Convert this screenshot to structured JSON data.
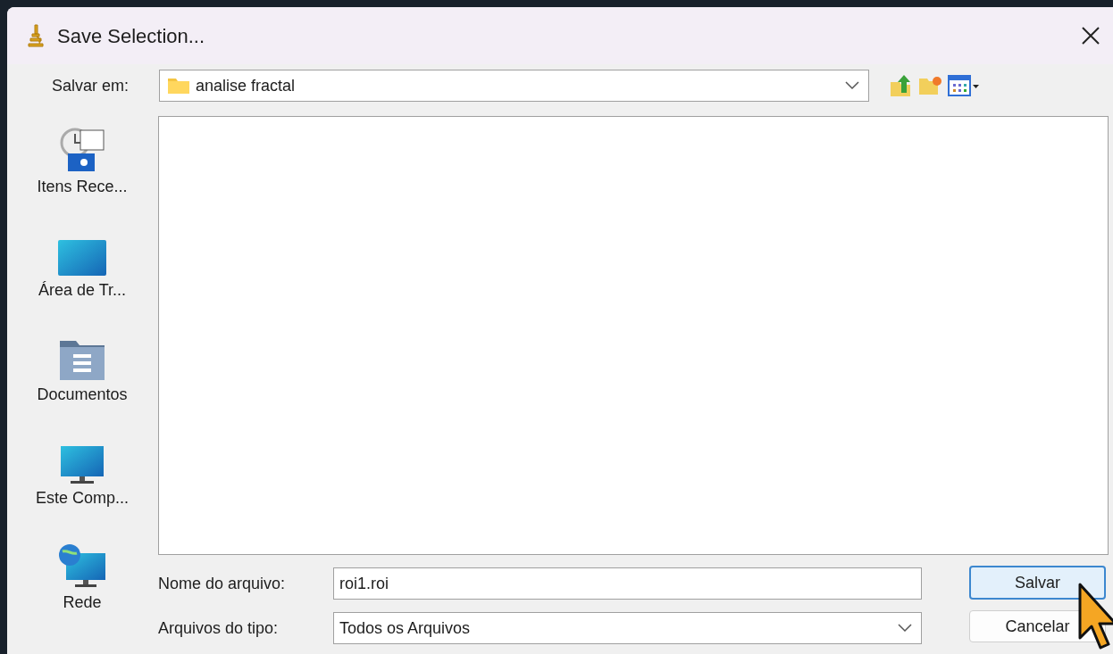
{
  "window": {
    "title": "Save Selection..."
  },
  "location": {
    "label": "Salvar em:",
    "value": "analise fractal"
  },
  "places": [
    {
      "label": "Itens Rece...",
      "kind": "recent"
    },
    {
      "label": "Área de Tr...",
      "kind": "desktop"
    },
    {
      "label": "Documentos",
      "kind": "documents"
    },
    {
      "label": "Este Comp...",
      "kind": "computer"
    },
    {
      "label": "Rede",
      "kind": "network"
    }
  ],
  "file_name": {
    "label": "Nome do arquivo:",
    "value": "roi1.roi"
  },
  "file_type": {
    "label": "Arquivos do tipo:",
    "value": "Todos os Arquivos"
  },
  "buttons": [
    {
      "label": "Salvar",
      "default": true
    },
    {
      "label": "Cancelar",
      "default": false
    }
  ]
}
